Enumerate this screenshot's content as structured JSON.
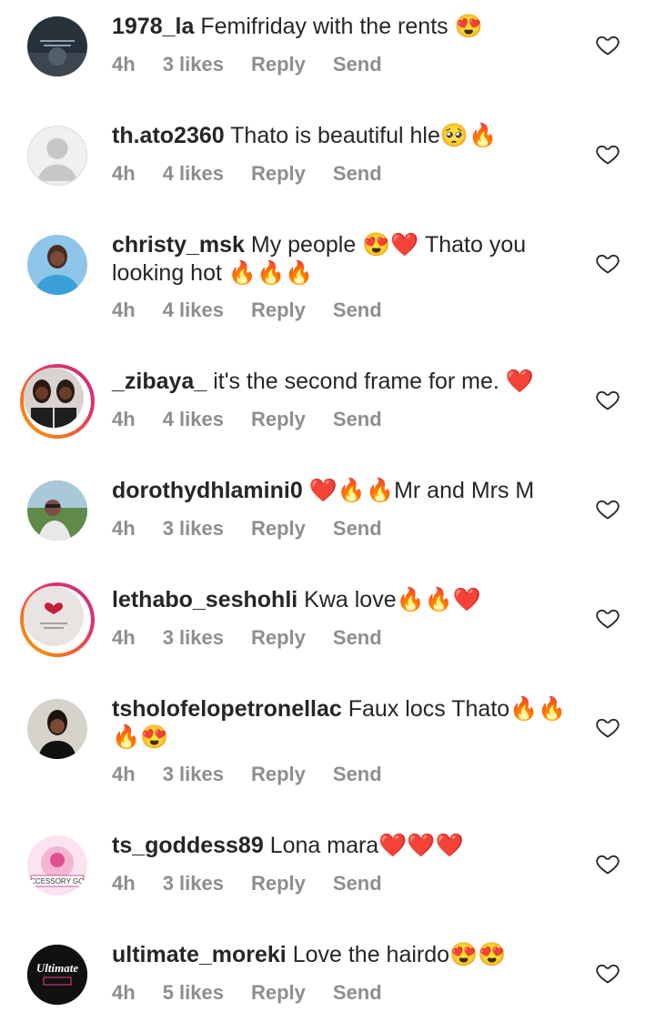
{
  "comments": [
    {
      "username": "1978_la",
      "text": " Femifriday with the rents ",
      "emojis": "😍",
      "time": "4h",
      "likes": "3 likes",
      "reply": "Reply",
      "send": "Send"
    },
    {
      "username": "th.ato2360",
      "text": " Thato is beautiful hle",
      "emojis": "🥺🔥",
      "time": "4h",
      "likes": "4 likes",
      "reply": "Reply",
      "send": "Send"
    },
    {
      "username": "christy_msk",
      "text": " My people ",
      "emojis": "😍❤️",
      "text2": " Thato you looking hot ",
      "emojis2": "🔥🔥🔥",
      "time": "4h",
      "likes": "4 likes",
      "reply": "Reply",
      "send": "Send"
    },
    {
      "username": "_zibaya_",
      "text": " it's the second frame for me. ",
      "emojis": "❤️",
      "time": "4h",
      "likes": "4 likes",
      "reply": "Reply",
      "send": "Send"
    },
    {
      "username": "dorothydhlamini0",
      "text": " ",
      "emojis": "❤️🔥🔥",
      "text2": "Mr and Mrs M",
      "time": "4h",
      "likes": "3 likes",
      "reply": "Reply",
      "send": "Send"
    },
    {
      "username": "lethabo_seshohli",
      "text": " Kwa love",
      "emojis": "🔥🔥❤️",
      "time": "4h",
      "likes": "3 likes",
      "reply": "Reply",
      "send": "Send"
    },
    {
      "username": "tsholofelopetronellac",
      "text": " Faux locs Thato",
      "emojis": "🔥🔥🔥😍",
      "time": "4h",
      "likes": "3 likes",
      "reply": "Reply",
      "send": "Send"
    },
    {
      "username": "ts_goddess89",
      "text": " Lona mara",
      "emojis": "❤️❤️❤️",
      "time": "4h",
      "likes": "3 likes",
      "reply": "Reply",
      "send": "Send"
    },
    {
      "username": "ultimate_moreki",
      "text": " Love the hairdo",
      "emojis": "😍😍",
      "time": "4h",
      "likes": "5 likes",
      "reply": "Reply",
      "send": "Send"
    }
  ],
  "avatar_logo_text": {
    "ts_goddess89": "ACCESSORY GOD",
    "ultimate_moreki": "Ultimate"
  }
}
